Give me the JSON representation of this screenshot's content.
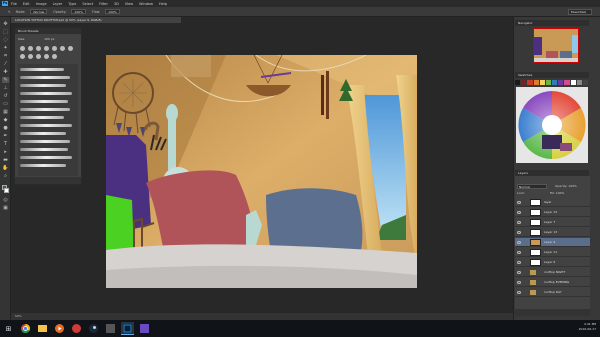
{
  "app": {
    "logo": "Ps",
    "menus": [
      "File",
      "Edit",
      "Image",
      "Layer",
      "Type",
      "Select",
      "Filter",
      "3D",
      "View",
      "Window",
      "Help"
    ]
  },
  "options": {
    "mode_label": "Mode:",
    "mode_value": "Normal",
    "opacity_label": "Opacity:",
    "opacity_value": "100%",
    "flow_label": "Flow:",
    "flow_value": "100%",
    "workspace": "Essentials"
  },
  "document": {
    "tab_title": "LOCATION TATTOO ROOFTOP.psd @ 50% (Layer 9, RGB/8)"
  },
  "brush_presets": {
    "title": "Brush Presets",
    "size_label": "Size:",
    "size_value": "100 px"
  },
  "navigator": {
    "title": "Navigator"
  },
  "swatches": {
    "title": "Swatches",
    "colors": [
      "#1a1a1a",
      "#7a2222",
      "#c23b2b",
      "#e07a2e",
      "#f2d15c",
      "#6fb24a",
      "#2f7fb6",
      "#6b3a9a",
      "#d04f8a",
      "#ffffff",
      "#888888",
      "#444444"
    ]
  },
  "layers": {
    "title": "Layers",
    "blend_mode": "Normal",
    "opacity_label": "Opacity:",
    "opacity_value": "100%",
    "lock_label": "Lock:",
    "fill_label": "Fill:",
    "fill_value": "100%",
    "items": [
      {
        "name": "layer",
        "type": "layer"
      },
      {
        "name": "Layer 12",
        "type": "layer"
      },
      {
        "name": "Layer 7",
        "type": "layer"
      },
      {
        "name": "Layer 13",
        "type": "layer"
      },
      {
        "name": "Layer 9",
        "type": "layer"
      },
      {
        "name": "Layer 11",
        "type": "layer"
      },
      {
        "name": "Layer 6",
        "type": "layer"
      },
      {
        "name": "rooftop NIGHT",
        "type": "group"
      },
      {
        "name": "rooftop EVENING",
        "type": "group"
      },
      {
        "name": "rooftop DAY",
        "type": "group"
      }
    ],
    "selected_index": 4
  },
  "status": {
    "zoom": "50%"
  },
  "taskbar": {
    "icons": [
      "windows-icon",
      "chrome-icon",
      "file-explorer-icon",
      "media-icon",
      "photoshop-icon",
      "steam-icon",
      "app-icon",
      "app-icon-2",
      "app-icon-3"
    ],
    "time": "4:41 PM",
    "date": "2016-06-17"
  }
}
